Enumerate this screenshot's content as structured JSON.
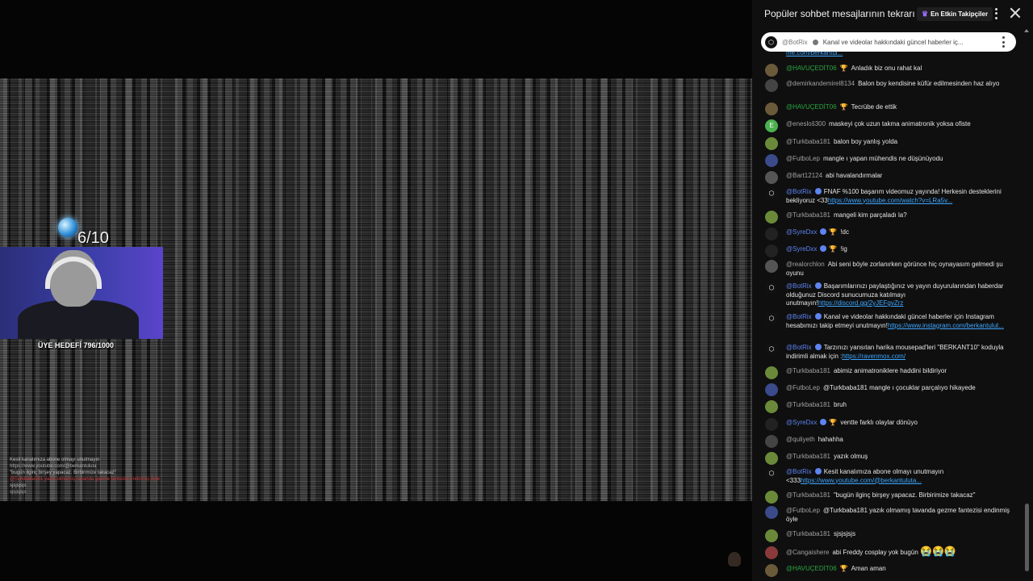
{
  "video": {
    "goal_count": "6/10",
    "goal_label": "ÜYE HEDEFİ 796/1000",
    "overlay_chat": [
      "Kesit kanalımıza abone olmayı unutmayın",
      "https://www.youtube.com/@berkantuluta",
      "\"bugün ilginç birşey yapacaz. Birbirimize takacaz\"",
      "@Turkbaba181 yazık olmamış tavanda gezme fantezisi endinmiş öyle",
      "sjsjsjsjs",
      "sjsjsjsjs"
    ]
  },
  "chat": {
    "header_title": "Popüler sohbet mesajlarının tekrarı",
    "members_label": "En Etkin Takipçiler",
    "pinned": {
      "author": "@BotRix",
      "text": "Kanal ve videolar hakkındaki güncel haberler iç..."
    },
    "cut_line": "me.com/berkantul...",
    "messages": [
      {
        "author": "@HAVUÇEDİT06",
        "text": "Anladık biz onu rahat kal",
        "link": "",
        "text2": ""
      },
      {
        "author": "@demirkandemirel8134",
        "text": "Balon boy kendisine küfür edilmesinden haz alıyo",
        "link": "",
        "text2": ""
      },
      {
        "author": "@HAVUÇEDİT06",
        "text": "Tecrübe de ettik",
        "link": "",
        "text2": ""
      },
      {
        "author": "@enesloš300",
        "text": "maskeyi çok uzun takma animatronik yoksa ofiste",
        "link": "",
        "text2": ""
      },
      {
        "author": "@Turkbaba181",
        "text": "balon boy yanlış yolda",
        "link": "",
        "text2": ""
      },
      {
        "author": "@FutboLep",
        "text": "mangle ı yapan mühendis ne düşünüyodu",
        "link": "",
        "text2": ""
      },
      {
        "author": "@Bart12124",
        "text": "abi havalandırmalar",
        "link": "",
        "text2": ""
      },
      {
        "author": "@BotRix",
        "text": "FNAF %100 başarım videomuz yayında! Herkesin desteklerini bekliyoruz <33",
        "link": "https://www.youtube.com/watch?v=LRa5v...",
        "text2": ""
      },
      {
        "author": "@Turkbaba181",
        "text": "mangeli kim parçaladı la?",
        "link": "",
        "text2": ""
      },
      {
        "author": "@SyreDxx",
        "text": "!dc",
        "link": "",
        "text2": ""
      },
      {
        "author": "@SyreDxx",
        "text": "!ig",
        "link": "",
        "text2": ""
      },
      {
        "author": "@realorchlon",
        "text": "Abi seni böyle zorlanırken görünce hiç oynayasım gelmedi şu oyunu",
        "link": "",
        "text2": ""
      },
      {
        "author": "@BotRix",
        "text": "Başarımlarınızı paylaştığınız ve yayın duyurularından haberdar olduğunuz Discord sunucumuza katılmayı unutmayın!",
        "link": "https://discord.gg/2yJEFgvZrz",
        "text2": ""
      },
      {
        "author": "@BotRix",
        "text": "Kanal ve videolar hakkındaki güncel haberler için Instagram hesabımızı takip etmeyi unutmayın!",
        "link": "https://www.instagram.com/berkantulut...",
        "text2": ""
      },
      {
        "author": "@BotRix",
        "text": "Tarzınızı yansıtan harika mousepad'leri \"BERKANT10\" koduyla indirimli almak için :",
        "link": "https://ravenmox.com/",
        "text2": ""
      },
      {
        "author": "@Turkbaba181",
        "text": "abimiz animatroniklere haddini bildiriyor",
        "link": "",
        "text2": ""
      },
      {
        "author": "@FutboLep",
        "text": "@Turkbaba181 mangle ı çocuklar parçalıyo hikayede",
        "link": "",
        "text2": ""
      },
      {
        "author": "@Turkbaba181",
        "text": "bruh",
        "link": "",
        "text2": ""
      },
      {
        "author": "@SyreDxx",
        "text": "ventte farklı olaylar dönüyo",
        "link": "",
        "text2": ""
      },
      {
        "author": "@quliyeth",
        "text": "hahahha",
        "link": "",
        "text2": ""
      },
      {
        "author": "@Turkbaba181",
        "text": "yazık olmuş",
        "link": "",
        "text2": ""
      },
      {
        "author": "@BotRix",
        "text": "Kesit kanalımıza abone olmayı unutmayın <333",
        "link": "https://www.youtube.com/@berkantuluta...",
        "text2": ""
      },
      {
        "author": "@Turkbaba181",
        "text": "\"bugün ilginç birşey yapacaz. Birbirimize takacaz\"",
        "link": "",
        "text2": ""
      },
      {
        "author": "@FutboLep",
        "text": "@Turkbaba181 yazık olmamış tavanda gezme fantezisi endinmiş öyle",
        "link": "",
        "text2": ""
      },
      {
        "author": "@Turkbaba181",
        "text": "sjsjsjsjs",
        "link": "",
        "text2": ""
      },
      {
        "author": "@Cangaishere",
        "text": "abi Freddy cosplay yok bugün",
        "link": "",
        "text2": "😭😭😭"
      },
      {
        "author": "@HAVUÇEDİT06",
        "text": "Aman aman",
        "link": "",
        "text2": ""
      }
    ]
  },
  "colors": {
    "link": "#3ea6ff",
    "moderator": "#5e84f1",
    "member": "#2ba640",
    "chat_bg": "#0f0f0f"
  },
  "icons": [
    "chevron-down-icon",
    "crown-icon",
    "more-vert-icon",
    "close-icon",
    "verified-check-icon",
    "trophy-icon"
  ]
}
